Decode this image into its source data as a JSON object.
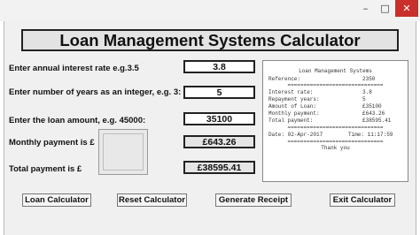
{
  "window": {
    "minimize_icon": "minimize-icon",
    "maximize_icon": "maximize-icon",
    "close_icon": "close-icon"
  },
  "title": "Loan Management Systems Calculator",
  "form": {
    "interest_label": "Enter annual interest rate e.g.3.5",
    "interest_value": "3.8",
    "years_label": "Enter number of years as an integer, e.g. 3:",
    "years_value": "5",
    "amount_label": "Enter the loan amount, e.g. 45000:",
    "amount_value": "35100",
    "monthly_label": "Monthly payment is £",
    "monthly_value": "£643.26",
    "total_label": "Total payment is £",
    "total_value": "£38595.41"
  },
  "receipt": {
    "heading": "Loan Management Systems",
    "rows": [
      {
        "label": "Reference:",
        "value": "2350"
      },
      {
        "label": "Interest rate:",
        "value": "3.8"
      },
      {
        "label": "Repayment years:",
        "value": "5"
      },
      {
        "label": "Amount of Loan:",
        "value": "£35100"
      },
      {
        "label": "Monthly payment:",
        "value": "£643.26"
      },
      {
        "label": "Total payment:",
        "value": "£38595.41"
      }
    ],
    "separator": "==============================",
    "date": "Date: 02-Apr-2017",
    "time": "Time: 11:17:59",
    "thanks": "Thank you"
  },
  "buttons": {
    "loan": "Loan Calculator",
    "reset": "Reset Calculator",
    "receipt": "Generate Receipt",
    "exit": "Exit Calculator"
  },
  "colors": {
    "close_button": "#c9302c",
    "frame": "#f0f0f0",
    "title_box": "#e3e3e3"
  }
}
